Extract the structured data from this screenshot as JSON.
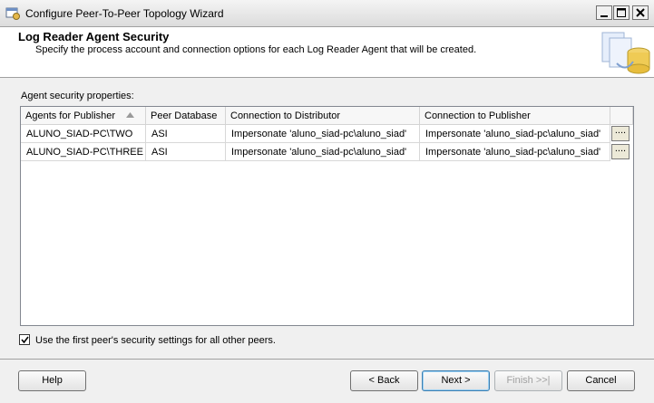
{
  "window": {
    "title": "Configure Peer-To-Peer Topology Wizard"
  },
  "header": {
    "title": "Log Reader Agent Security",
    "subtitle": "Specify the process account and connection options for each Log Reader Agent that will be created."
  },
  "group": {
    "label": "Agent security properties:"
  },
  "grid": {
    "columns": [
      "Agents for Publisher",
      "Peer Database",
      "Connection to Distributor",
      "Connection to Publisher"
    ],
    "rows": [
      {
        "agent": "ALUNO_SIAD-PC\\TWO",
        "database": "ASI",
        "distributor": "Impersonate 'aluno_siad-pc\\aluno_siad'",
        "publisher": "Impersonate 'aluno_siad-pc\\aluno_siad'",
        "button": "...."
      },
      {
        "agent": "ALUNO_SIAD-PC\\THREE",
        "database": "ASI",
        "distributor": "Impersonate 'aluno_siad-pc\\aluno_siad'",
        "publisher": "Impersonate 'aluno_siad-pc\\aluno_siad'",
        "button": "...."
      }
    ]
  },
  "option": {
    "label": "Use the first peer's security settings for all other peers.",
    "checked": true
  },
  "buttons": {
    "help": "Help",
    "back": "< Back",
    "next": "Next >",
    "finish": "Finish >>|",
    "cancel": "Cancel"
  }
}
